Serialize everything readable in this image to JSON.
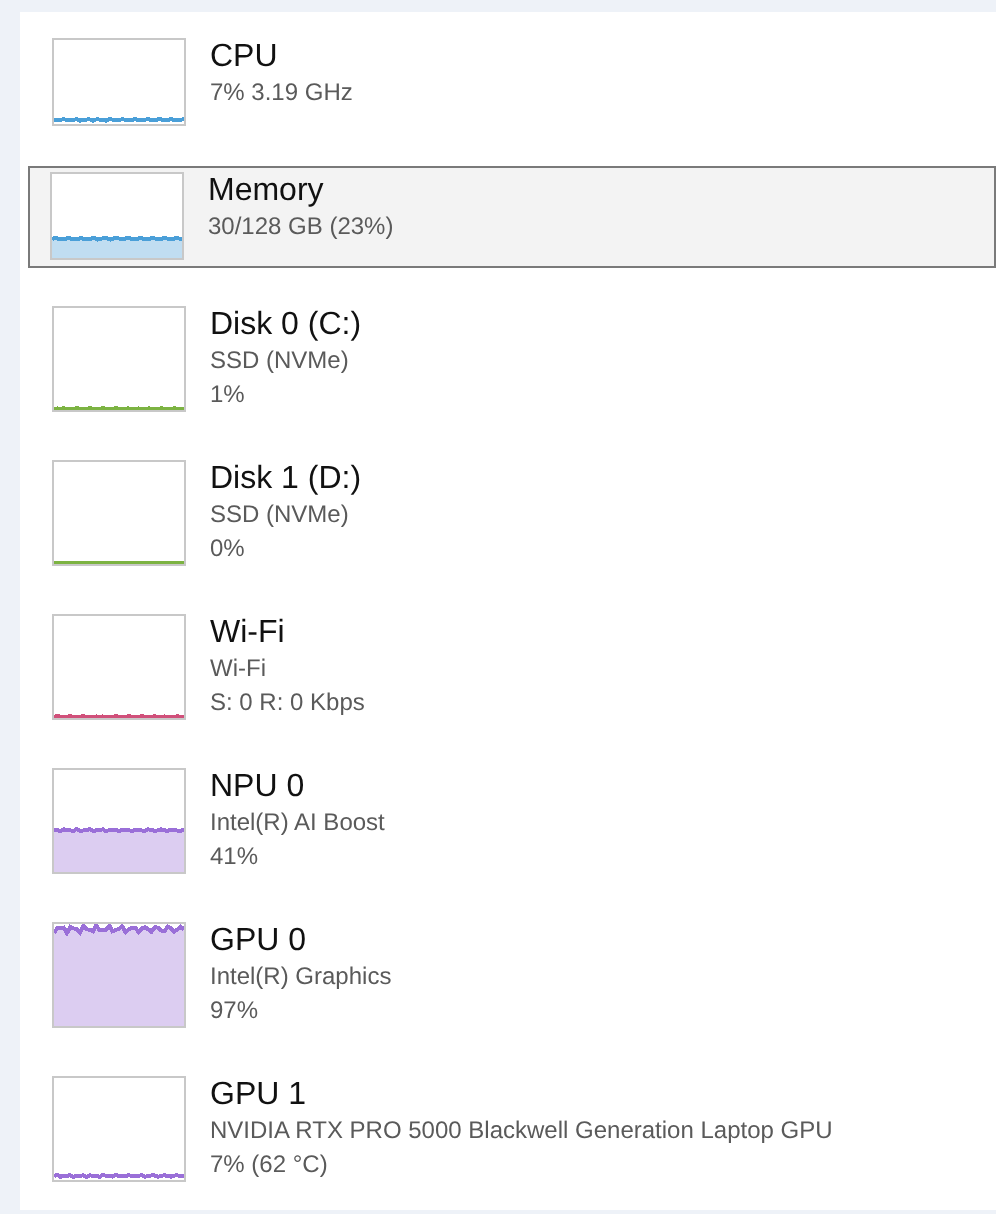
{
  "resources": [
    {
      "name": "CPU",
      "details": [
        "7%  3.19 GHz"
      ],
      "color": "#4a9fd8",
      "selected": false
    },
    {
      "name": "Memory",
      "details": [
        "30/128 GB (23%)"
      ],
      "color": "#4a9fd8",
      "selected": true
    },
    {
      "name": "Disk 0 (C:)",
      "details": [
        "SSD (NVMe)",
        "1%"
      ],
      "color": "#7cb342",
      "selected": false
    },
    {
      "name": "Disk 1 (D:)",
      "details": [
        "SSD (NVMe)",
        "0%"
      ],
      "color": "#7cb342",
      "selected": false
    },
    {
      "name": "Wi-Fi",
      "details": [
        "Wi-Fi",
        "S: 0  R: 0 Kbps"
      ],
      "color": "#d0507a",
      "selected": false
    },
    {
      "name": "NPU 0",
      "details": [
        "Intel(R) AI Boost",
        "41%"
      ],
      "color": "#9a6fd8",
      "selected": false
    },
    {
      "name": "GPU 0",
      "details": [
        "Intel(R) Graphics",
        "97%"
      ],
      "color": "#9a6fd8",
      "selected": false
    },
    {
      "name": "GPU 1",
      "details": [
        "NVIDIA RTX PRO 5000 Blackwell Generation Laptop GPU",
        "7%  (62 °C)"
      ],
      "color": "#9a6fd8",
      "selected": false
    }
  ]
}
